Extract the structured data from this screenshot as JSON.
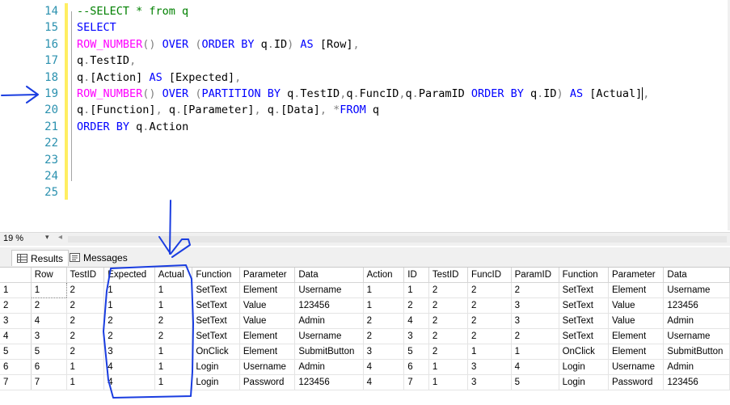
{
  "editor": {
    "line_numbers": [
      "14",
      "15",
      "16",
      "17",
      "18",
      "19",
      "20",
      "21",
      "22",
      "23",
      "24",
      "25"
    ],
    "lines": [
      [
        {
          "t": "--SELECT * from q",
          "c": "cm"
        }
      ],
      [
        {
          "t": "SELECT",
          "c": "kw"
        }
      ],
      [
        {
          "t": "ROW_NUMBER",
          "c": "fn"
        },
        {
          "t": "() ",
          "c": "gy"
        },
        {
          "t": "OVER ",
          "c": "kw"
        },
        {
          "t": "(",
          "c": "gy"
        },
        {
          "t": "ORDER BY ",
          "c": "kw"
        },
        {
          "t": "q",
          "c": ""
        },
        {
          "t": ".",
          "c": "gy"
        },
        {
          "t": "ID",
          "c": ""
        },
        {
          "t": ") ",
          "c": "gy"
        },
        {
          "t": "AS ",
          "c": "kw"
        },
        {
          "t": "[Row]",
          "c": ""
        },
        {
          "t": ",",
          "c": "gy"
        }
      ],
      [
        {
          "t": "q",
          "c": ""
        },
        {
          "t": ".",
          "c": "gy"
        },
        {
          "t": "TestID",
          "c": ""
        },
        {
          "t": ",",
          "c": "gy"
        }
      ],
      [
        {
          "t": "q",
          "c": ""
        },
        {
          "t": ".",
          "c": "gy"
        },
        {
          "t": "[Action] ",
          "c": ""
        },
        {
          "t": "AS ",
          "c": "kw"
        },
        {
          "t": "[Expected]",
          "c": ""
        },
        {
          "t": ",",
          "c": "gy"
        }
      ],
      [
        {
          "t": "ROW_NUMBER",
          "c": "fn"
        },
        {
          "t": "() ",
          "c": "gy"
        },
        {
          "t": "OVER ",
          "c": "kw"
        },
        {
          "t": "(",
          "c": "gy"
        },
        {
          "t": "PARTITION BY ",
          "c": "kw"
        },
        {
          "t": "q",
          "c": ""
        },
        {
          "t": ".",
          "c": "gy"
        },
        {
          "t": "TestID",
          "c": ""
        },
        {
          "t": ",",
          "c": "gy"
        },
        {
          "t": "q",
          "c": ""
        },
        {
          "t": ".",
          "c": "gy"
        },
        {
          "t": "FuncID",
          "c": ""
        },
        {
          "t": ",",
          "c": "gy"
        },
        {
          "t": "q",
          "c": ""
        },
        {
          "t": ".",
          "c": "gy"
        },
        {
          "t": "ParamID ",
          "c": ""
        },
        {
          "t": "ORDER BY ",
          "c": "kw"
        },
        {
          "t": "q",
          "c": ""
        },
        {
          "t": ".",
          "c": "gy"
        },
        {
          "t": "ID",
          "c": ""
        },
        {
          "t": ") ",
          "c": "gy"
        },
        {
          "t": "AS ",
          "c": "kw"
        },
        {
          "t": "[Actual]",
          "c": ""
        },
        {
          "t": "CARET",
          "c": "caret"
        },
        {
          "t": ",",
          "c": "gy"
        }
      ],
      [
        {
          "t": "q",
          "c": ""
        },
        {
          "t": ".",
          "c": "gy"
        },
        {
          "t": "[Function]",
          "c": ""
        },
        {
          "t": ", ",
          "c": "gy"
        },
        {
          "t": "q",
          "c": ""
        },
        {
          "t": ".",
          "c": "gy"
        },
        {
          "t": "[Parameter]",
          "c": ""
        },
        {
          "t": ", ",
          "c": "gy"
        },
        {
          "t": "q",
          "c": ""
        },
        {
          "t": ".",
          "c": "gy"
        },
        {
          "t": "[Data]",
          "c": ""
        },
        {
          "t": ", ",
          "c": "gy"
        },
        {
          "t": "*",
          "c": "gy"
        },
        {
          "t": "FROM ",
          "c": "kw"
        },
        {
          "t": "q",
          "c": ""
        }
      ],
      [
        {
          "t": "ORDER BY ",
          "c": "kw"
        },
        {
          "t": "q",
          "c": ""
        },
        {
          "t": ".",
          "c": "gy"
        },
        {
          "t": "Action",
          "c": ""
        }
      ],
      [],
      [],
      [],
      []
    ]
  },
  "zoom": {
    "value": "19 %"
  },
  "tabs": {
    "results_label": "Results",
    "messages_label": "Messages"
  },
  "results": {
    "columns": [
      "",
      "Row",
      "TestID",
      "Expected",
      "Actual",
      "Function",
      "Parameter",
      "Data",
      "Action",
      "ID",
      "TestID",
      "FuncID",
      "ParamID",
      "Function",
      "Parameter",
      "Data"
    ],
    "rows": [
      [
        "1",
        "1",
        "2",
        "1",
        "1",
        "SetText",
        "Element",
        "Username",
        "1",
        "1",
        "2",
        "2",
        "2",
        "SetText",
        "Element",
        "Username"
      ],
      [
        "2",
        "2",
        "2",
        "1",
        "1",
        "SetText",
        "Value",
        "123456",
        "1",
        "2",
        "2",
        "2",
        "3",
        "SetText",
        "Value",
        "123456"
      ],
      [
        "3",
        "4",
        "2",
        "2",
        "2",
        "SetText",
        "Value",
        "Admin",
        "2",
        "4",
        "2",
        "2",
        "3",
        "SetText",
        "Value",
        "Admin"
      ],
      [
        "4",
        "3",
        "2",
        "2",
        "2",
        "SetText",
        "Element",
        "Username",
        "2",
        "3",
        "2",
        "2",
        "2",
        "SetText",
        "Element",
        "Username"
      ],
      [
        "5",
        "5",
        "2",
        "3",
        "1",
        "OnClick",
        "Element",
        "SubmitButton",
        "3",
        "5",
        "2",
        "1",
        "1",
        "OnClick",
        "Element",
        "SubmitButton"
      ],
      [
        "6",
        "6",
        "1",
        "4",
        "1",
        "Login",
        "Username",
        "Admin",
        "4",
        "6",
        "1",
        "3",
        "4",
        "Login",
        "Username",
        "Admin"
      ],
      [
        "7",
        "7",
        "1",
        "4",
        "1",
        "Login",
        "Password",
        "123456",
        "4",
        "7",
        "1",
        "3",
        "5",
        "Login",
        "Password",
        "123456"
      ]
    ]
  },
  "colors": {
    "line_number": "#2b91af",
    "keyword": "#0000ff",
    "function": "#ff00ff",
    "comment": "#008000",
    "annotation_ink": "#1a3de0"
  }
}
